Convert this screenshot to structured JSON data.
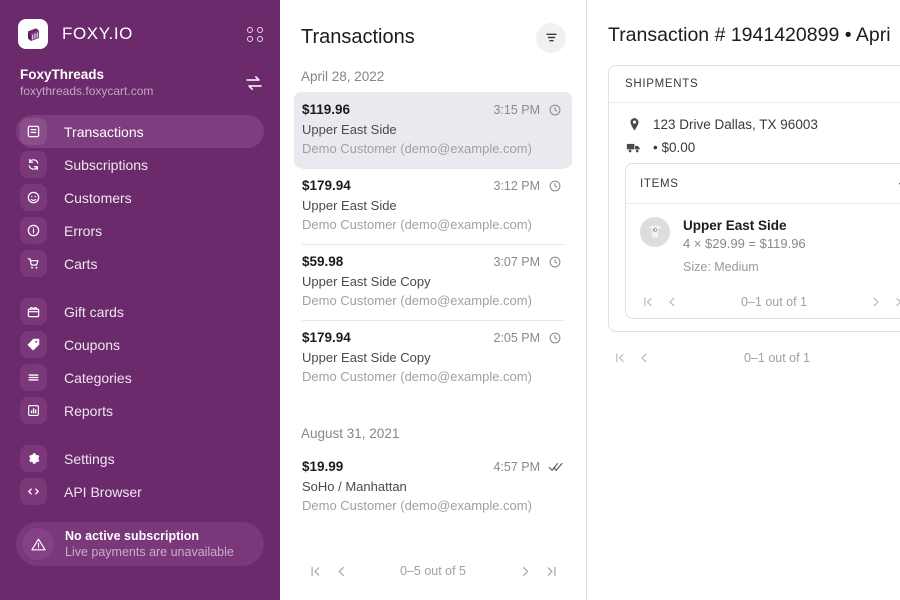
{
  "sidebar": {
    "brand": "FOXY.IO",
    "apps_icon": "apps-grid-icon",
    "logo_icon": "foxy-logo-icon",
    "store": {
      "name": "FoxyThreads",
      "url": "foxythreads.foxycart.com",
      "swap_icon": "swap-store-icon"
    },
    "nav_primary": [
      {
        "label": "Transactions",
        "icon": "receipt-icon",
        "active": true
      },
      {
        "label": "Subscriptions",
        "icon": "refresh-icon",
        "active": false
      },
      {
        "label": "Customers",
        "icon": "face-icon",
        "active": false
      },
      {
        "label": "Errors",
        "icon": "info-circle-icon",
        "active": false
      },
      {
        "label": "Carts",
        "icon": "shopping-cart-icon",
        "active": false
      }
    ],
    "nav_secondary": [
      {
        "label": "Gift cards",
        "icon": "gift-card-icon",
        "active": false
      },
      {
        "label": "Coupons",
        "icon": "tag-icon",
        "active": false
      },
      {
        "label": "Categories",
        "icon": "list-lines-icon",
        "active": false
      },
      {
        "label": "Reports",
        "icon": "bar-chart-icon",
        "active": false
      }
    ],
    "nav_tertiary": [
      {
        "label": "Settings",
        "icon": "gear-icon",
        "active": false
      },
      {
        "label": "API Browser",
        "icon": "code-brackets-icon",
        "active": false
      }
    ],
    "notice": {
      "icon": "warning-triangle-icon",
      "title": "No active subscription",
      "subtitle": "Live payments are unavailable"
    }
  },
  "list": {
    "title": "Transactions",
    "filter_icon": "filter-icon",
    "groups": [
      {
        "date": "April 28, 2022",
        "rows": [
          {
            "amount": "$119.96",
            "time": "3:15 PM",
            "status_icon": "clock-icon",
            "product": "Upper East Side",
            "customer": "Demo Customer (demo@example.com)",
            "selected": true
          },
          {
            "amount": "$179.94",
            "time": "3:12 PM",
            "status_icon": "clock-icon",
            "product": "Upper East Side",
            "customer": "Demo Customer (demo@example.com)",
            "selected": false
          },
          {
            "amount": "$59.98",
            "time": "3:07 PM",
            "status_icon": "clock-icon",
            "product": "Upper East Side Copy",
            "customer": "Demo Customer (demo@example.com)",
            "selected": false
          },
          {
            "amount": "$179.94",
            "time": "2:05 PM",
            "status_icon": "clock-icon",
            "product": "Upper East Side Copy",
            "customer": "Demo Customer (demo@example.com)",
            "selected": false
          }
        ]
      },
      {
        "date": "August 31, 2021",
        "rows": [
          {
            "amount": "$19.99",
            "time": "4:57 PM",
            "status_icon": "double-check-icon",
            "product": "SoHo / Manhattan",
            "customer": "Demo Customer (demo@example.com)",
            "selected": false
          }
        ]
      }
    ],
    "pager": {
      "label": "0–5 out of 5",
      "first_icon": "first-page-icon",
      "prev_icon": "prev-page-icon",
      "next_icon": "next-page-icon",
      "last_icon": "last-page-icon"
    }
  },
  "detail": {
    "title": "Transaction # 1941420899 • Apri",
    "shipments_card": {
      "header": "SHIPMENTS",
      "address": "123 Drive Dallas, TX 96003",
      "address_icon": "location-pin-icon",
      "shipping": "• $0.00",
      "shipping_icon": "truck-icon",
      "items_card": {
        "header": "ITEMS",
        "collapse_icon": "chevron-up-icon",
        "item": {
          "thumb_icon": "tshirt-thumbnail",
          "name": "Upper East Side",
          "calc": "4 × $29.99 = $119.96",
          "option": "Size: Medium"
        },
        "pager": {
          "label": "0–1 out of 1",
          "first_icon": "first-page-icon",
          "prev_icon": "prev-page-icon",
          "next_icon": "next-page-icon",
          "last_icon": "last-page-icon"
        }
      }
    },
    "pager": {
      "label": "0–1 out of 1",
      "first_icon": "first-page-icon",
      "prev_icon": "prev-page-icon",
      "next_icon": "next-page-icon"
    }
  },
  "colors": {
    "sidebar_purple": "#6b2a6b",
    "active_pill": "#7e3d7e",
    "selected_row": "#ece8ef",
    "accent_purple": "#7a2f7a"
  }
}
